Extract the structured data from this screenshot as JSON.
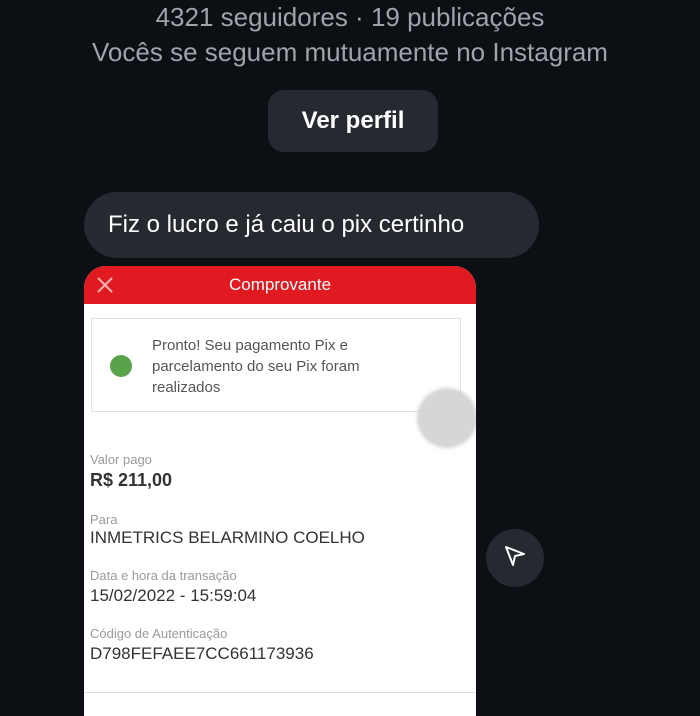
{
  "profile": {
    "stats": "4321 seguidores · 19 publicações",
    "mutual": "Vocês se seguem mutuamente no Instagram",
    "view_profile_label": "Ver perfil"
  },
  "message": {
    "text": "Fiz o lucro e já caiu o pix certinho"
  },
  "receipt": {
    "title": "Comprovante",
    "close_icon": "close-icon",
    "notice_line1": "Pronto! Seu pagamento Pix e",
    "notice_line2": "parcelamento do seu Pix foram",
    "notice_line3": "realizados",
    "amount_label": "Valor pago",
    "amount_value": "R$ 211,00",
    "to_label": "Para",
    "to_value": "INMETRICS BELARMINO COELHO",
    "datetime_label": "Data e hora da transação",
    "datetime_value": "15/02/2022 - 15:59:04",
    "auth_label": "Código de Autenticação",
    "auth_value": "D798FEFAEE7CC661173936",
    "header_color": "#e01a20",
    "check_color": "#5aa34a"
  },
  "actions": {
    "send_icon": "send-icon"
  }
}
